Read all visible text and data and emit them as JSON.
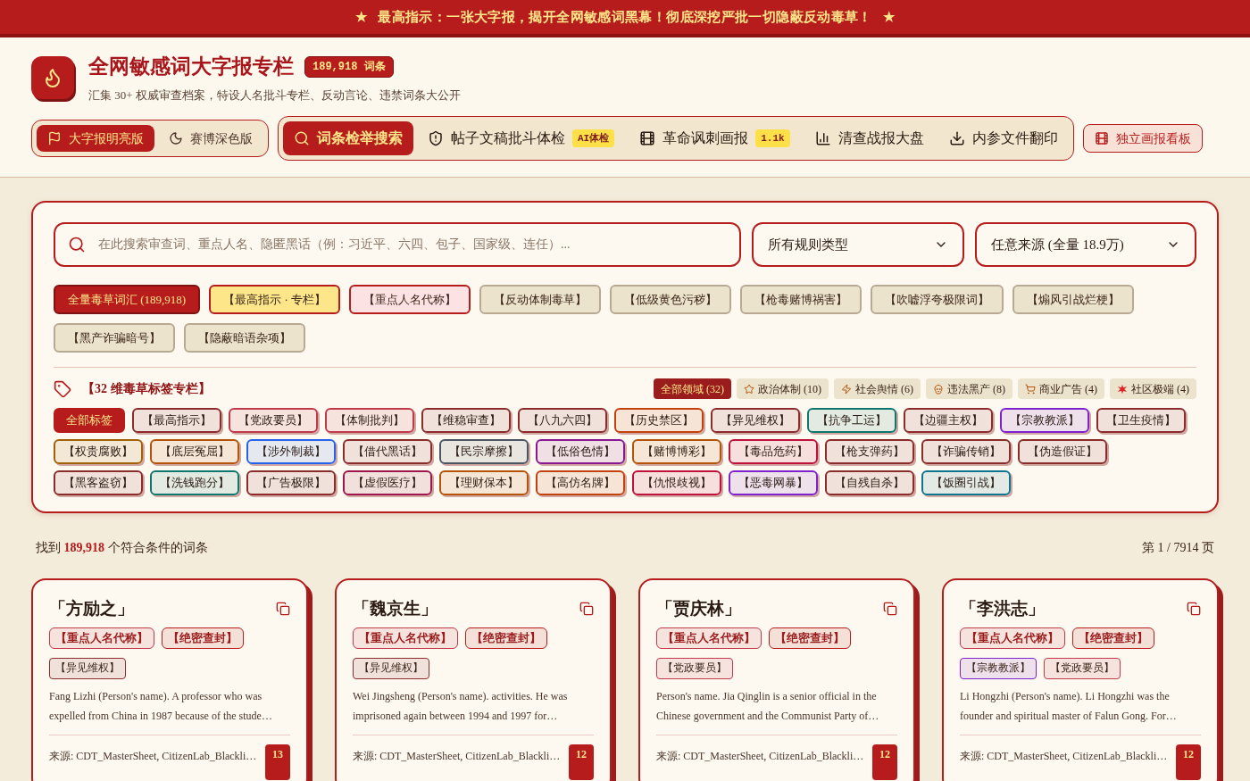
{
  "banner": {
    "star_left": "★",
    "text": "最高指示：一张大字报，揭开全网敏感词黑幕！彻底深挖严批一切隐蔽反动毒草！",
    "star_right": "★"
  },
  "header": {
    "title": "全网敏感词大字报专栏",
    "count_badge": "189,918 词条",
    "subtitle": "汇集 30+ 权威审查档案，特设人名批斗专栏、反动言论、违禁词条大公开"
  },
  "theme_toggle": [
    {
      "label": "大字报明亮版",
      "selected": true
    },
    {
      "label": "赛博深色版",
      "selected": false
    }
  ],
  "nav_tabs": [
    {
      "label": "词条检举搜索",
      "selected": true
    },
    {
      "label": "帖子文稿批斗体检",
      "badge": "AI体检",
      "selected": false
    },
    {
      "label": "革命讽刺画报",
      "badge": "1.1k",
      "selected": false
    },
    {
      "label": "清查战报大盘",
      "selected": false
    },
    {
      "label": "内参文件翻印",
      "selected": false
    }
  ],
  "board_button": "独立画报看板",
  "search": {
    "placeholder": "在此搜索审查词、重点人名、隐匿黑话（例：习近平、六四、包子、国家级、连任）...",
    "rule_select": "所有规则类型",
    "source_select": "任意来源 (全量 18.9万)"
  },
  "rule_filters": [
    {
      "label": "全量毒草词汇 (189,918)",
      "color": "#b71c1c",
      "selected": true
    },
    {
      "label": "【最高指示 · 专栏】",
      "color": "#fde68a",
      "selected": false
    },
    {
      "label": "【重点人名代称】",
      "color": "#fde2e4",
      "selected": false
    },
    {
      "label": "【反动体制毒草】",
      "color": "#ece3cc",
      "selected": false
    },
    {
      "label": "【低级黄色污秽】",
      "color": "#ece3cc",
      "selected": false
    },
    {
      "label": "【枪毒赌博祸害】",
      "color": "#ece3cc",
      "selected": false
    },
    {
      "label": "【吹嘘浮夸极限词】",
      "color": "#ece3cc",
      "selected": false
    },
    {
      "label": "【煽风引战烂梗】",
      "color": "#ece3cc",
      "selected": false
    },
    {
      "label": "【黑产诈骗暗号】",
      "color": "#ece3cc",
      "selected": false
    },
    {
      "label": "【隐蔽暗语杂项】",
      "color": "#ece3cc",
      "selected": false
    }
  ],
  "tag_section": {
    "title": "【32 维毒草标签专栏】",
    "domains": [
      {
        "label": "全部领域 (32)",
        "selected": true
      },
      {
        "label": "政治体制 (10)",
        "selected": false
      },
      {
        "label": "社会舆情 (6)",
        "selected": false
      },
      {
        "label": "违法黑产 (8)",
        "selected": false
      },
      {
        "label": "商业广告 (4)",
        "selected": false
      },
      {
        "label": "社区极端 (4)",
        "selected": false
      }
    ],
    "tags": [
      {
        "label": "全部标签",
        "color": "#b71c1c",
        "selected": true
      },
      {
        "label": "【最高指示】",
        "color": "#8b2c2c",
        "selected": false
      },
      {
        "label": "【党政要员】",
        "color": "#c0394b",
        "selected": false
      },
      {
        "label": "【体制批判】",
        "color": "#c0394b",
        "selected": false
      },
      {
        "label": "【维稳审查】",
        "color": "#8b2c2c",
        "selected": false
      },
      {
        "label": "【八九六四】",
        "color": "#8b2c2c",
        "selected": false
      },
      {
        "label": "【历史禁区】",
        "color": "#c2410c",
        "selected": false
      },
      {
        "label": "【异见维权】",
        "color": "#8b2c2c",
        "selected": false
      },
      {
        "label": "【抗争工运】",
        "color": "#0f766e",
        "selected": false
      },
      {
        "label": "【边疆主权】",
        "color": "#8b2c2c",
        "selected": false
      },
      {
        "label": "【宗教教派】",
        "color": "#7e22ce",
        "selected": false
      },
      {
        "label": "【卫生疫情】",
        "color": "#8b2c2c",
        "selected": false
      },
      {
        "label": "【权贵腐败】",
        "color": "#a16207",
        "selected": false
      },
      {
        "label": "【底层冤屈】",
        "color": "#b45309",
        "selected": false
      },
      {
        "label": "【涉外制裁】",
        "color": "#2563eb",
        "selected": false
      },
      {
        "label": "【借代黑话】",
        "color": "#8b2c2c",
        "selected": false
      },
      {
        "label": "【民宗摩擦】",
        "color": "#4b5563",
        "selected": false
      },
      {
        "label": "【低俗色情】",
        "color": "#86198f",
        "selected": false
      },
      {
        "label": "【赌博博彩】",
        "color": "#b45309",
        "selected": false
      },
      {
        "label": "【毒品危药】",
        "color": "#be123c",
        "selected": false
      },
      {
        "label": "【枪支弹药】",
        "color": "#8b2c2c",
        "selected": false
      },
      {
        "label": "【诈骗传销】",
        "color": "#8b2c2c",
        "selected": false
      },
      {
        "label": "【伪造假证】",
        "color": "#8b2c2c",
        "selected": false
      },
      {
        "label": "【黑客盗窃】",
        "color": "#8b2c2c",
        "selected": false
      },
      {
        "label": "【洗钱跑分】",
        "color": "#0f766e",
        "selected": false
      },
      {
        "label": "【广告极限】",
        "color": "#8b2c2c",
        "selected": false
      },
      {
        "label": "【虚假医疗】",
        "color": "#9d174d",
        "selected": false
      },
      {
        "label": "【理财保本】",
        "color": "#b45309",
        "selected": false
      },
      {
        "label": "【高仿名牌】",
        "color": "#c2410c",
        "selected": false
      },
      {
        "label": "【仇恨歧视】",
        "color": "#be123c",
        "selected": false
      },
      {
        "label": "【恶毒网暴】",
        "color": "#7e22ce",
        "selected": false
      },
      {
        "label": "【自残自杀】",
        "color": "#8b2c2c",
        "selected": false
      },
      {
        "label": "【饭圈引战】",
        "color": "#0e7490",
        "selected": false
      }
    ]
  },
  "results": {
    "prefix": "找到",
    "count": "189,918",
    "suffix": "个符合条件的词条",
    "page": "第 1 / 7914 页"
  },
  "cards": [
    {
      "term": "「方励之」",
      "rule_tags": [
        {
          "label": "【重点人名代称】",
          "color": "#c0394b"
        },
        {
          "label": "【绝密查封】",
          "color": "#b91c1c"
        }
      ],
      "topic_tags": [
        {
          "label": "【异见维权】",
          "color": "#8b2c2c"
        }
      ],
      "description": "Fang Lizhi (Person's name). A professor who was expelled from China in 1987 because of the stude…",
      "source": "来源: CDT_MasterSheet, CitizenLab_Blackli…",
      "source_count": "13"
    },
    {
      "term": "「魏京生」",
      "rule_tags": [
        {
          "label": "【重点人名代称】",
          "color": "#c0394b"
        },
        {
          "label": "【绝密查封】",
          "color": "#b91c1c"
        }
      ],
      "topic_tags": [
        {
          "label": "【异见维权】",
          "color": "#8b2c2c"
        }
      ],
      "description": "Wei Jingsheng (Person's name). activities. He was imprisoned again between 1994 and 1997 for…",
      "source": "来源: CDT_MasterSheet, CitizenLab_Blackli…",
      "source_count": "12"
    },
    {
      "term": "「贾庆林」",
      "rule_tags": [
        {
          "label": "【重点人名代称】",
          "color": "#c0394b"
        },
        {
          "label": "【绝密查封】",
          "color": "#b91c1c"
        }
      ],
      "topic_tags": [
        {
          "label": "【党政要员】",
          "color": "#c0394b"
        }
      ],
      "description": "Person's name. Jia Qinglin is a senior official in the Chinese government and the Communist Party of…",
      "source": "来源: CDT_MasterSheet, CitizenLab_Blackli…",
      "source_count": "12"
    },
    {
      "term": "「李洪志」",
      "rule_tags": [
        {
          "label": "【重点人名代称】",
          "color": "#c0394b"
        },
        {
          "label": "【绝密查封】",
          "color": "#b91c1c"
        }
      ],
      "topic_tags": [
        {
          "label": "【宗教教派】",
          "color": "#7e22ce"
        },
        {
          "label": "【党政要员】",
          "color": "#c0394b"
        }
      ],
      "description": "Li Hongzhi (Person's name). Li Hongzhi was the founder and spiritual master of Falun Gong. For…",
      "source": "来源: CDT_MasterSheet, CitizenLab_Blackli…",
      "source_count": "12"
    }
  ]
}
